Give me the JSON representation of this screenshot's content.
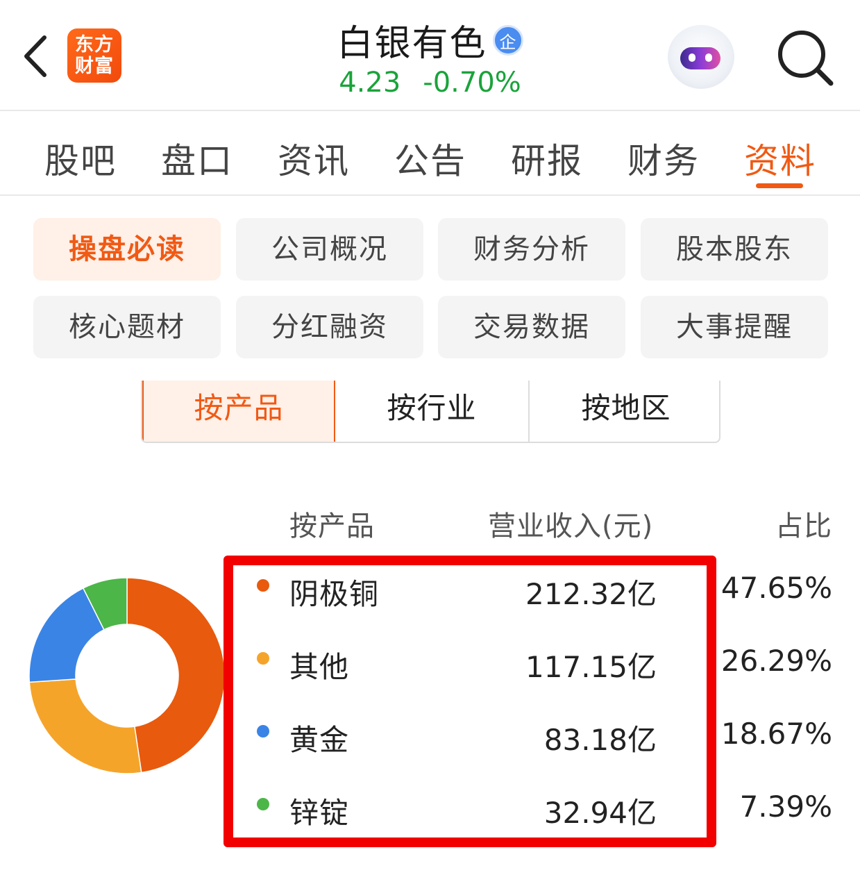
{
  "header": {
    "logo_line1": "东方",
    "logo_line2": "财富",
    "stock_name": "白银有色",
    "badge": "企",
    "price": "4.23",
    "change_pct": "-0.70%"
  },
  "tabs": [
    {
      "label": "股吧"
    },
    {
      "label": "盘口"
    },
    {
      "label": "资讯"
    },
    {
      "label": "公告"
    },
    {
      "label": "研报"
    },
    {
      "label": "财务"
    },
    {
      "label": "资料",
      "active": true
    }
  ],
  "sections": [
    {
      "label": "操盘必读",
      "active": true
    },
    {
      "label": "公司概况"
    },
    {
      "label": "财务分析"
    },
    {
      "label": "股本股东"
    },
    {
      "label": "核心题材"
    },
    {
      "label": "分红融资"
    },
    {
      "label": "交易数据"
    },
    {
      "label": "大事提醒"
    }
  ],
  "segments": [
    {
      "label": "按产品",
      "active": true
    },
    {
      "label": "按行业"
    },
    {
      "label": "按地区"
    }
  ],
  "table": {
    "col_category": "按产品",
    "col_revenue": "营业收入(元)",
    "col_share": "占比",
    "rows": [
      {
        "name": "阴极铜",
        "revenue": "212.32亿",
        "share": "47.65%",
        "share_value": 47.65,
        "color": "#e85a0e"
      },
      {
        "name": "其他",
        "revenue": "117.15亿",
        "share": "26.29%",
        "share_value": 26.29,
        "color": "#f5a42a"
      },
      {
        "name": "黄金",
        "revenue": "83.18亿",
        "share": "18.67%",
        "share_value": 18.67,
        "color": "#3a84e6"
      },
      {
        "name": "锌锭",
        "revenue": "32.94亿",
        "share": "7.39%",
        "share_value": 7.39,
        "color": "#4cb648"
      }
    ]
  },
  "colors": {
    "accent": "#f05a14",
    "price_down": "#1aa33a",
    "highlight_box": "#f20000"
  }
}
